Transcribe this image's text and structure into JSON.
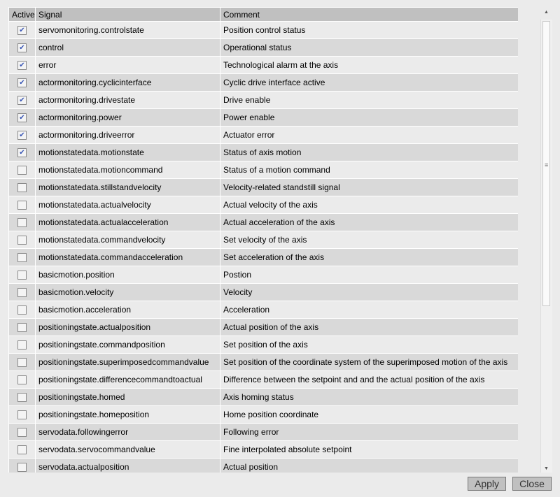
{
  "table": {
    "headers": [
      "Active",
      "Signal",
      "Comment"
    ],
    "rows": [
      {
        "active": true,
        "signal": "servomonitoring.controlstate",
        "comment": "Position control status"
      },
      {
        "active": true,
        "signal": "control",
        "comment": "Operational status"
      },
      {
        "active": true,
        "signal": "error",
        "comment": "Technological alarm at the axis"
      },
      {
        "active": true,
        "signal": "actormonitoring.cyclicinterface",
        "comment": "Cyclic drive interface active"
      },
      {
        "active": true,
        "signal": "actormonitoring.drivestate",
        "comment": "Drive enable"
      },
      {
        "active": true,
        "signal": "actormonitoring.power",
        "comment": "Power enable"
      },
      {
        "active": true,
        "signal": "actormonitoring.driveerror",
        "comment": "Actuator error"
      },
      {
        "active": true,
        "signal": "motionstatedata.motionstate",
        "comment": "Status of axis motion"
      },
      {
        "active": false,
        "signal": "motionstatedata.motioncommand",
        "comment": "Status of a motion command"
      },
      {
        "active": false,
        "signal": "motionstatedata.stillstandvelocity",
        "comment": "Velocity-related standstill signal"
      },
      {
        "active": false,
        "signal": "motionstatedata.actualvelocity",
        "comment": "Actual velocity of the axis"
      },
      {
        "active": false,
        "signal": "motionstatedata.actualacceleration",
        "comment": "Actual acceleration of the axis"
      },
      {
        "active": false,
        "signal": "motionstatedata.commandvelocity",
        "comment": "Set velocity of the axis"
      },
      {
        "active": false,
        "signal": "motionstatedata.commandacceleration",
        "comment": "Set acceleration of the axis"
      },
      {
        "active": false,
        "signal": "basicmotion.position",
        "comment": "Postion"
      },
      {
        "active": false,
        "signal": "basicmotion.velocity",
        "comment": "Velocity"
      },
      {
        "active": false,
        "signal": "basicmotion.acceleration",
        "comment": "Acceleration"
      },
      {
        "active": false,
        "signal": "positioningstate.actualposition",
        "comment": "Actual position of the axis"
      },
      {
        "active": false,
        "signal": "positioningstate.commandposition",
        "comment": "Set position of the axis"
      },
      {
        "active": false,
        "signal": "positioningstate.superimposedcommandvalue",
        "comment": "Set position of the coordinate system of the superimposed motion of the axis"
      },
      {
        "active": false,
        "signal": "positioningstate.differencecommandtoactual",
        "comment": "Difference between the setpoint and and the actual position of the axis"
      },
      {
        "active": false,
        "signal": "positioningstate.homed",
        "comment": "Axis homing status"
      },
      {
        "active": false,
        "signal": "positioningstate.homeposition",
        "comment": "Home position coordinate"
      },
      {
        "active": false,
        "signal": "servodata.followingerror",
        "comment": "Following error"
      },
      {
        "active": false,
        "signal": "servodata.servocommandvalue",
        "comment": "Fine interpolated absolute setpoint"
      },
      {
        "active": false,
        "signal": "servodata.actualposition",
        "comment": "Actual position"
      }
    ]
  },
  "buttons": {
    "apply": "Apply",
    "close": "Close"
  },
  "colors": {
    "header": "#c0c0c0",
    "row_light": "#ebebeb",
    "row_dark": "#d9d9d9",
    "check": "#3a57b5"
  }
}
